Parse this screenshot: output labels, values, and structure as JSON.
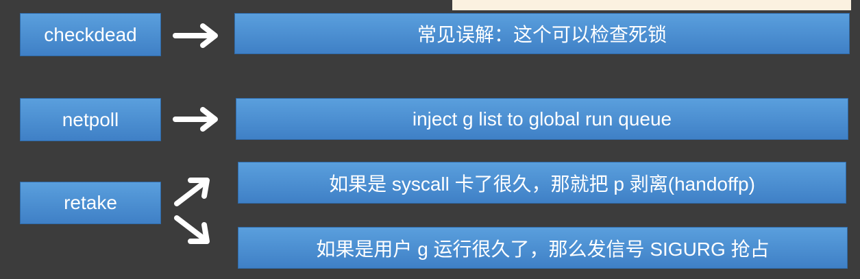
{
  "diagram": {
    "sources": [
      {
        "label": "checkdead"
      },
      {
        "label": "netpoll"
      },
      {
        "label": "retake"
      }
    ],
    "targets": [
      {
        "label": "常见误解：这个可以检查死锁"
      },
      {
        "label": "inject g list to global run queue"
      },
      {
        "label": "如果是 syscall 卡了很久，那就把 p 剥离(handoffp)"
      },
      {
        "label": "如果是用户 g 运行很久了，那么发信号 SIGURG 抢占"
      }
    ],
    "edges": [
      {
        "from": "checkdead",
        "to": "常见误解：这个可以检查死锁"
      },
      {
        "from": "netpoll",
        "to": "inject g list to global run queue"
      },
      {
        "from": "retake",
        "to": "如果是 syscall 卡了很久，那就把 p 剥离(handoffp)"
      },
      {
        "from": "retake",
        "to": "如果是用户 g 运行很久了，那么发信号 SIGURG 抢占"
      }
    ]
  },
  "colors": {
    "background": "#3c3c3c",
    "box_fill_top": "#5a9fdd",
    "box_fill_bottom": "#3f80c6",
    "arrow": "#ffffff"
  }
}
